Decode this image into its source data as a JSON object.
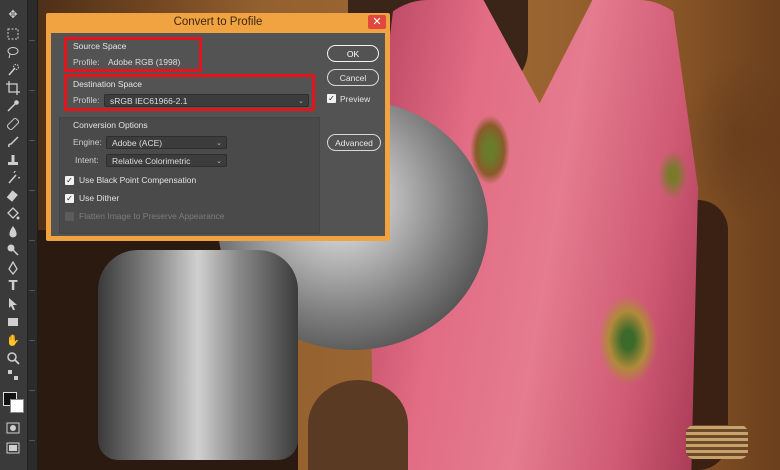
{
  "dialog": {
    "title": "Convert to Profile",
    "close_icon": "close-icon",
    "source_space": {
      "heading": "Source Space",
      "profile_label": "Profile:",
      "profile_value": "Adobe RGB (1998)"
    },
    "destination_space": {
      "heading": "Destination Space",
      "profile_label": "Profile:",
      "profile_value": "sRGB IEC61966-2.1"
    },
    "conversion_options": {
      "heading": "Conversion Options",
      "engine_label": "Engine:",
      "engine_value": "Adobe (ACE)",
      "intent_label": "Intent:",
      "intent_value": "Relative Colorimetric",
      "black_point": {
        "label": "Use Black Point Compensation",
        "checked": true
      },
      "dither": {
        "label": "Use Dither",
        "checked": true
      },
      "flatten": {
        "label": "Flatten Image to Preserve Appearance",
        "checked": false,
        "disabled": true
      }
    },
    "buttons": {
      "ok": "OK",
      "cancel": "Cancel",
      "advanced": "Advanced"
    },
    "preview": {
      "label": "Preview",
      "checked": true
    },
    "highlight_color": "#e3141b",
    "frame_color": "#f1a341"
  },
  "toolbar": {
    "tools": [
      "move-icon",
      "marquee-icon",
      "lasso-icon",
      "quick-select-icon",
      "crop-icon",
      "eyedropper-icon",
      "healing-icon",
      "brush-icon",
      "stamp-icon",
      "history-brush-icon",
      "eraser-icon",
      "bucket-icon",
      "blur-icon",
      "dodge-icon",
      "pen-icon",
      "type-icon",
      "path-select-icon",
      "rectangle-icon",
      "hand-icon",
      "zoom-icon"
    ]
  }
}
